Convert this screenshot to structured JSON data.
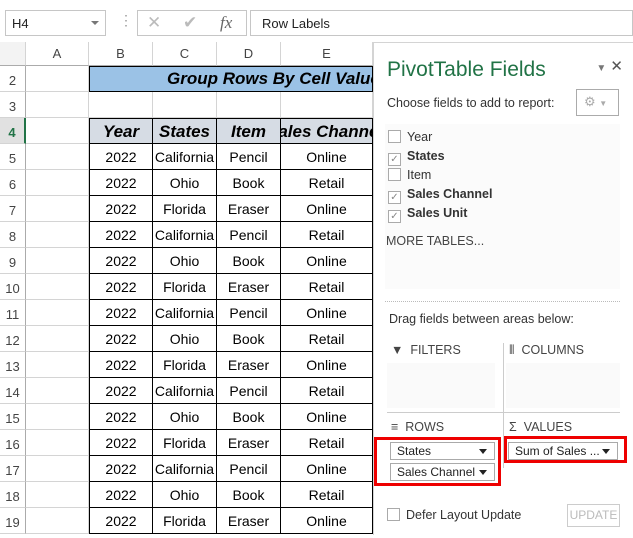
{
  "formula_bar": {
    "name_box": "H4",
    "formula": "Row Labels",
    "fx": "fx",
    "cancel": "✕",
    "enter": "✔"
  },
  "columns": [
    "A",
    "B",
    "C",
    "D",
    "E"
  ],
  "row_numbers": [
    "2",
    "3",
    "4",
    "5",
    "6",
    "7",
    "8",
    "9",
    "10",
    "11",
    "12",
    "13",
    "14",
    "15",
    "16",
    "17",
    "18",
    "19"
  ],
  "title": "Group Rows By Cell Value",
  "headers": [
    "Year",
    "States",
    "Item",
    "Sales Channel"
  ],
  "rows": [
    [
      "2022",
      "California",
      "Pencil",
      "Online"
    ],
    [
      "2022",
      "Ohio",
      "Book",
      "Retail"
    ],
    [
      "2022",
      "Florida",
      "Eraser",
      "Online"
    ],
    [
      "2022",
      "California",
      "Pencil",
      "Retail"
    ],
    [
      "2022",
      "Ohio",
      "Book",
      "Online"
    ],
    [
      "2022",
      "Florida",
      "Eraser",
      "Retail"
    ],
    [
      "2022",
      "California",
      "Pencil",
      "Online"
    ],
    [
      "2022",
      "Ohio",
      "Book",
      "Retail"
    ],
    [
      "2022",
      "Florida",
      "Eraser",
      "Online"
    ],
    [
      "2022",
      "California",
      "Pencil",
      "Retail"
    ],
    [
      "2022",
      "Ohio",
      "Book",
      "Online"
    ],
    [
      "2022",
      "Florida",
      "Eraser",
      "Retail"
    ],
    [
      "2022",
      "California",
      "Pencil",
      "Online"
    ],
    [
      "2022",
      "Ohio",
      "Book",
      "Retail"
    ],
    [
      "2022",
      "Florida",
      "Eraser",
      "Online"
    ]
  ],
  "pane": {
    "title": "PivotTable Fields",
    "choose": "Choose fields to add to report:",
    "fields": [
      {
        "label": "Year",
        "checked": false
      },
      {
        "label": "States",
        "checked": true
      },
      {
        "label": "Item",
        "checked": false
      },
      {
        "label": "Sales Channel",
        "checked": true
      },
      {
        "label": "Sales Unit",
        "checked": true
      }
    ],
    "more_tables": "MORE TABLES...",
    "drag": "Drag fields between areas below:",
    "filters": "FILTERS",
    "columns": "COLUMNS",
    "rows": "ROWS",
    "values": "VALUES",
    "row_fields": [
      "States",
      "Sales Channel"
    ],
    "value_fields": [
      "Sum of Sales ..."
    ],
    "defer": "Defer Layout Update",
    "update": "UPDATE"
  },
  "colors": {
    "accent": "#217346",
    "title_fill": "#9bc2e6",
    "header_fill": "#d6dce4",
    "highlight": "#e00000"
  }
}
